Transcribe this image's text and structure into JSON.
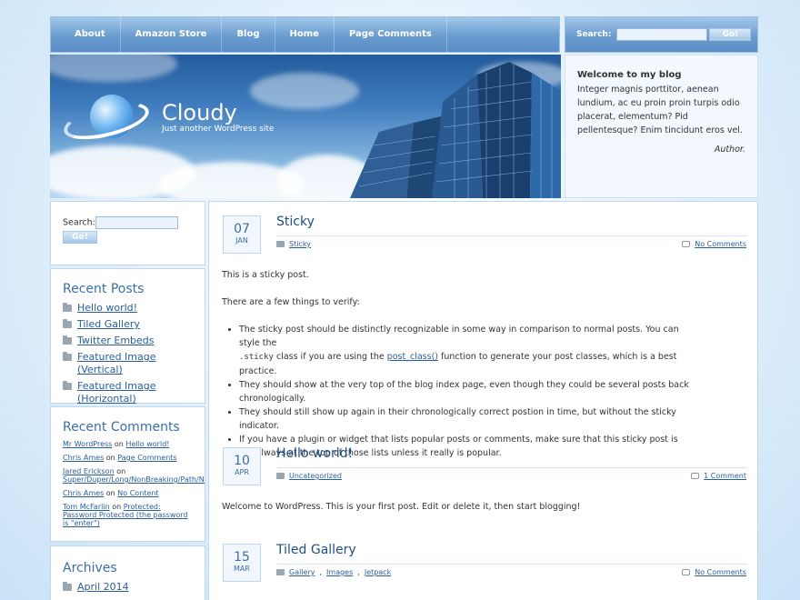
{
  "nav": {
    "items": [
      "About",
      "Amazon Store",
      "Blog",
      "Home",
      "Page Comments"
    ],
    "search_label": "Search:",
    "go_label": "Go!"
  },
  "header": {
    "site_title": "Cloudy",
    "tagline": "Just another WordPress site"
  },
  "welcome": {
    "title": "Welcome to my blog",
    "text": "Integer magnis porttitor, aenean lundium, ac eu proin proin turpis odio placerat, elementum? Pid pellentesque? Enim tincidunt eros vel.",
    "author": "Author."
  },
  "sidebar": {
    "search_label": "Search:",
    "go_label": "Go!",
    "recent_posts_title": "Recent Posts",
    "recent_posts": [
      "Hello world!",
      "Tiled Gallery",
      "Twitter Embeds",
      "Featured Image (Vertical)",
      "Featured Image (Horizontal)"
    ],
    "recent_comments_title": "Recent Comments",
    "recent_comments": [
      {
        "author": "Mr WordPress",
        "on": "on",
        "post": "Hello world!"
      },
      {
        "author": "Chris Ames",
        "on": "on",
        "post": "Page Comments"
      },
      {
        "author": "Jared Erickson",
        "on": "on",
        "post": "Super/Duper/Long/NonBreaking/Path/Name"
      },
      {
        "author": "Chris Ames",
        "on": "on",
        "post": "No Content"
      },
      {
        "author": "Tom McFarlin",
        "on": "on",
        "post": "Protected: Password Protected (the password is \"enter\")"
      }
    ],
    "archives_title": "Archives",
    "archives": [
      "April 2014"
    ]
  },
  "posts": [
    {
      "day": "07",
      "month": "JAN",
      "title": "Sticky",
      "categories": "Sticky",
      "comments": "No Comments",
      "p1": "This is a sticky post.",
      "p2": "There are a few things to verify:",
      "li1_a": "The sticky post should be distinctly recognizable in some way in comparison to normal posts. You can style the ",
      "li1_code": ".sticky",
      "li1_b": " class if you are using the ",
      "li1_link": "post_class()",
      "li1_c": " function to generate your post classes, which is a best practice.",
      "li2": "They should show at the very top of the blog index page, even though they could be several posts back chronologically.",
      "li3": "They should still show up again in their chronologically correct postion in time, but without the sticky indicator.",
      "li4": "If you have a plugin or widget that lists popular posts or comments, make sure that this sticky post is not always at the top of those lists unless it really is popular."
    },
    {
      "day": "10",
      "month": "APR",
      "title": "Hello world!",
      "categories": "Uncategorized",
      "comments": "1 Comment",
      "p1": "Welcome to WordPress. This is your first post. Edit or delete it, then start blogging!"
    },
    {
      "day": "15",
      "month": "MAR",
      "title": "Tiled Gallery",
      "cat1": "Gallery",
      "cat2": "Images",
      "cat3": "Jetpack",
      "comments": "No Comments"
    }
  ],
  "colors": {
    "accent": "#3a6ea5",
    "link": "#2a5e9a",
    "nav": "#6a9ccf"
  }
}
